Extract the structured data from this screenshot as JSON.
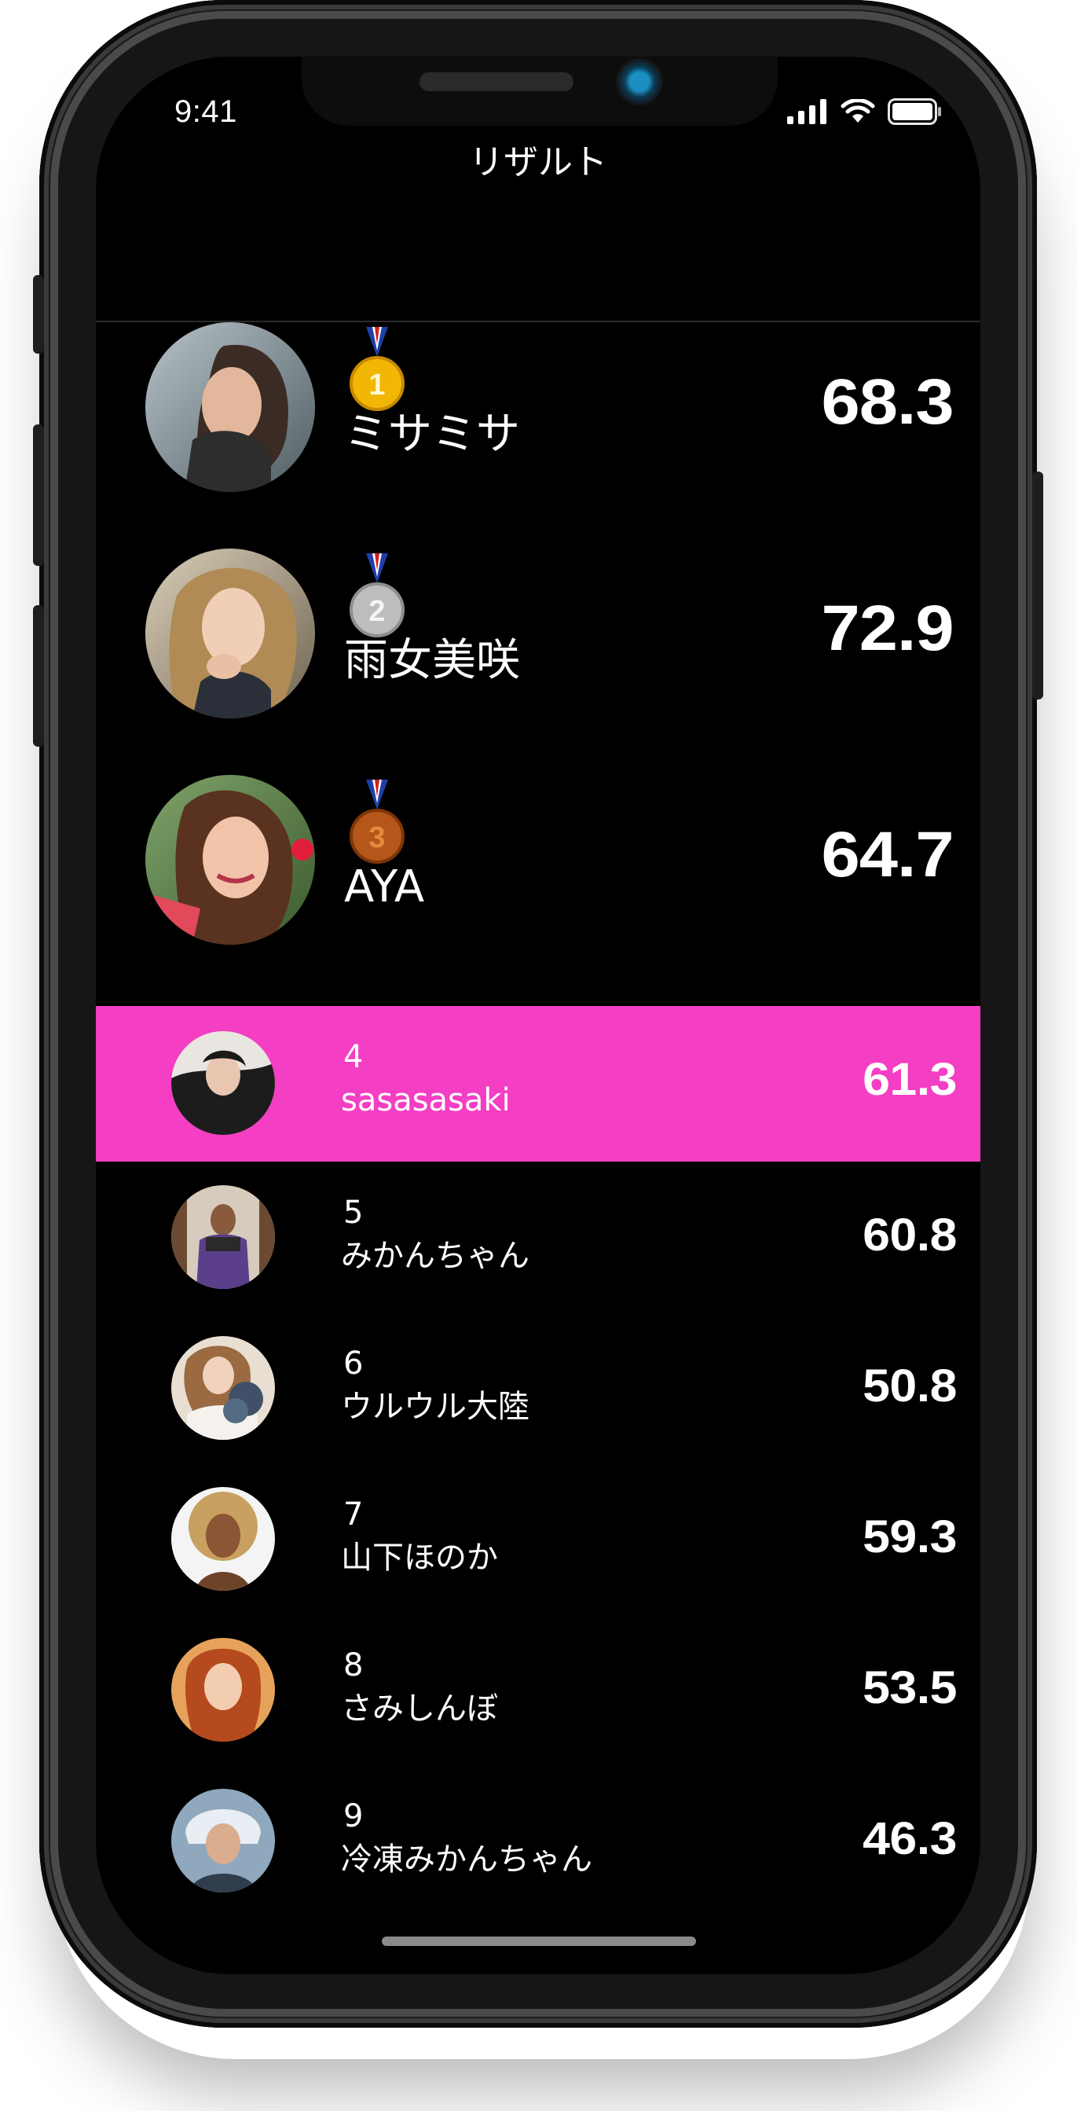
{
  "status_bar": {
    "time": "9:41"
  },
  "nav": {
    "title": "リザルト"
  },
  "podium": [
    {
      "rank": 1,
      "medal": "gold-medal-icon",
      "name": "ミサミサ",
      "score": "68.3"
    },
    {
      "rank": 2,
      "medal": "silver-medal-icon",
      "name": "雨女美咲",
      "score": "72.9"
    },
    {
      "rank": 3,
      "medal": "bronze-medal-icon",
      "name": "AYA",
      "score": "64.7"
    }
  ],
  "ranking": [
    {
      "rank": "4",
      "name": "sasasasaki",
      "score": "61.3",
      "highlighted": true
    },
    {
      "rank": "5",
      "name": "みかんちゃん",
      "score": "60.8"
    },
    {
      "rank": "6",
      "name": "ウルウル大陸",
      "score": "50.8"
    },
    {
      "rank": "7",
      "name": "山下ほのか",
      "score": "59.3"
    },
    {
      "rank": "8",
      "name": "さみしんぼ",
      "score": "53.5"
    },
    {
      "rank": "9",
      "name": "冷凍みかんちゃん",
      "score": "46.3"
    }
  ],
  "colors": {
    "background": "#000000",
    "highlight_row": "#f43ec4",
    "text": "#ffffff",
    "gold": "#f2b705",
    "silver": "#bdbdbd",
    "bronze": "#b5561a"
  }
}
